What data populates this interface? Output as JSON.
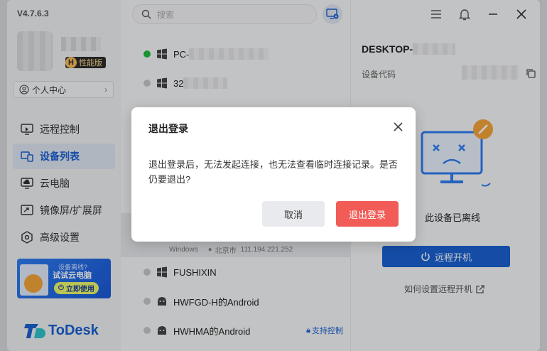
{
  "app": {
    "version": "V4.7.6.3",
    "logo_text": "ToDesk"
  },
  "user": {
    "edition_badge": "性能版",
    "edition_mark": "H",
    "center_label": "个人中心"
  },
  "nav": [
    {
      "label": "远程控制",
      "icon": "remote-control-icon"
    },
    {
      "label": "设备列表",
      "icon": "device-list-icon"
    },
    {
      "label": "云电脑",
      "icon": "cloud-pc-icon"
    },
    {
      "label": "镜像屏/扩展屏",
      "icon": "mirror-screen-icon"
    },
    {
      "label": "高级设置",
      "icon": "advanced-settings-icon"
    }
  ],
  "promo": {
    "question": "设备离线?",
    "title": "试试云电脑",
    "button": "立即使用"
  },
  "search": {
    "placeholder": "搜索"
  },
  "devices": [
    {
      "prefix": "PC-",
      "online": true,
      "os": "windows-icon"
    },
    {
      "prefix": "32",
      "online": false,
      "os": "windows-icon"
    },
    {
      "prefix": "FUSHIXIN",
      "online": false,
      "os": "windows-icon"
    },
    {
      "prefix": "HWFGD-H的Android",
      "online": false,
      "os": "android-icon"
    },
    {
      "prefix": "HWHMA的Android",
      "online": false,
      "os": "android-icon",
      "tag": "支持控制"
    }
  ],
  "selected_device": {
    "os": "Windows",
    "location": "北京市",
    "ip": "111.194.221.252"
  },
  "detail": {
    "title_prefix": "DESKTOP-",
    "code_label": "设备代码",
    "offline_text": "此设备已离线",
    "wake_button": "远程开机",
    "howto_link": "如何设置远程开机"
  },
  "dialog": {
    "title": "退出登录",
    "message": "退出登录后，无法发起连接，也无法查看临时连接记录。是否仍要退出?",
    "cancel": "取消",
    "confirm": "退出登录"
  },
  "colors": {
    "accent": "#1a5fd0",
    "danger": "#f25c57",
    "online": "#21b83f"
  }
}
